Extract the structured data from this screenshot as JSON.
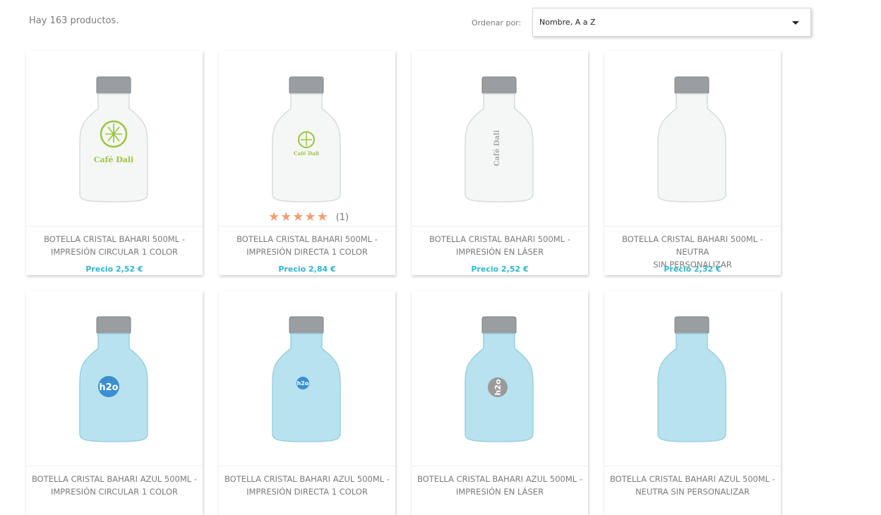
{
  "header": {
    "count_text": "Hay 163 productos.",
    "sort_label": "Ordenar por:",
    "sort_value": "Nombre, A a Z"
  },
  "colors": {
    "price": "#2fb5d2",
    "star": "#f39d72",
    "clear_bottle": "#f5f6f6",
    "blue_bottle": "#b9e2ef"
  },
  "products": [
    {
      "title_1": "BOTELLA CRISTAL BAHARI 500ML -",
      "title_2": "IMPRESIÓN CIRCULAR 1 COLOR",
      "price": "Precio 2,52 €",
      "logo": "Café Dali",
      "logo_text": "Café Dali"
    },
    {
      "title_1": "BOTELLA CRISTAL BAHARI 500ML -",
      "title_2": "IMPRESIÓN DIRECTA 1 COLOR",
      "price": "Precio 2,84 €",
      "logo": "Café Dali",
      "logo_text": "Café Dali",
      "rating": {
        "stars": 5,
        "count": "(1)"
      }
    },
    {
      "title_1": "BOTELLA CRISTAL BAHARI 500ML -",
      "title_2": "IMPRESIÓN EN LÁSER",
      "price": "Precio 2,52 €",
      "logo": "Café Dali",
      "logo_text": "Café Dali"
    },
    {
      "title_1": "BOTELLA CRISTAL BAHARI 500ML - NEUTRA",
      "title_2": "SIN PERSONALIZAR",
      "price": "Precio 2,32 €"
    },
    {
      "title_1": "BOTELLA CRISTAL BAHARI AZUL 500ML -",
      "title_2": "IMPRESIÓN CIRCULAR 1 COLOR",
      "logo": "h2o",
      "logo_text": "h2o"
    },
    {
      "title_1": "BOTELLA CRISTAL BAHARI AZUL 500ML -",
      "title_2": "IMPRESIÓN DIRECTA 1 COLOR",
      "logo": "h2o",
      "logo_text": "h2o"
    },
    {
      "title_1": "BOTELLA CRISTAL BAHARI AZUL 500ML -",
      "title_2": "IMPRESIÓN EN LÁSER",
      "logo": "h2o",
      "logo_text": "h2o"
    },
    {
      "title_1": "BOTELLA CRISTAL BAHARI AZUL 500ML -",
      "title_2": "NEUTRA SIN PERSONALIZAR"
    }
  ]
}
